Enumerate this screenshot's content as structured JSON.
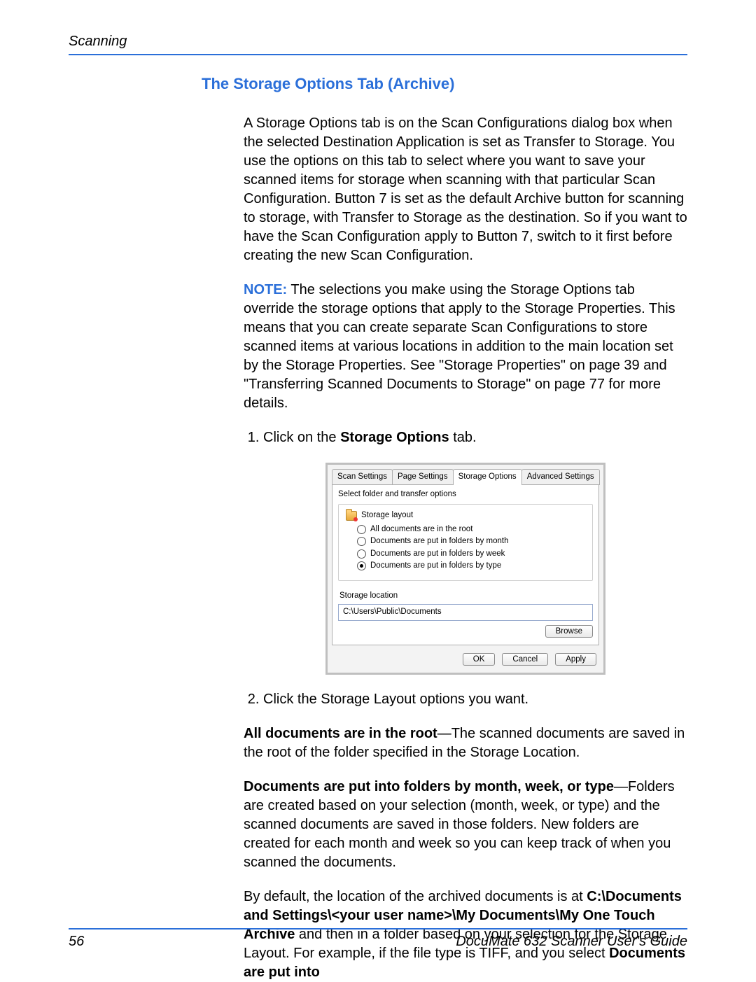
{
  "header": {
    "left": "Scanning",
    "right": ""
  },
  "section_title": "The Storage Options Tab (Archive)",
  "intro_paragraph": "A Storage Options tab is on the Scan Configurations dialog box when the selected Destination Application is set as Transfer to Storage. You use the options on this tab to select where you want to save your scanned items for storage when scanning with that particular Scan Configuration. Button 7 is set as the default Archive button for scanning to storage, with Transfer to Storage as the destination. So if you want to have the Scan Configuration apply to Button 7, switch to it first before creating the new Scan Configuration.",
  "note": {
    "label": "NOTE:",
    "text": "The selections you make using the Storage Options tab override the storage options that apply to the Storage Properties. This means that you can create separate Scan Configurations to store scanned items at various locations in addition to the main location set by the Storage Properties. See \"Storage Properties\" on page 39 and \"Transferring Scanned Documents to Storage\" on page 77 for more details."
  },
  "steps": {
    "s1_pre": "Click on the ",
    "s1_bold": "Storage Options",
    "s1_post": " tab.",
    "s2": "Click the Storage Layout options you want."
  },
  "explanations": {
    "root_bold": "All documents are in the root",
    "root_rest": "—The scanned documents are saved in the root of the folder specified in the Storage Location.",
    "folders_bold": "Documents are put into folders by month, week, or type",
    "folders_rest": "—Folders are created based on your selection (month, week, or type) and the scanned documents are saved in those folders. New folders are created for each month and week so you can keep track of when you scanned the documents.",
    "default_pre": "By default, the location of the archived documents is at ",
    "default_path": "C:\\Documents and Settings\\<your user name>\\My Documents\\My One Touch Archive",
    "default_mid": " and then in a folder based on your selection for the Storage Layout. For example, if the file type is TIFF, and you select ",
    "default_trail_bold": "Documents are put into"
  },
  "dialog": {
    "tabs": [
      "Scan Settings",
      "Page Settings",
      "Storage Options",
      "Advanced Settings"
    ],
    "active_tab_index": 2,
    "panel_label": "Select folder and transfer options",
    "group_title": "Storage layout",
    "options": [
      "All documents are in the root",
      "Documents are put in folders by month",
      "Documents are put in folders by week",
      "Documents are put in folders by type"
    ],
    "selected_option_index": 3,
    "location_label": "Storage location",
    "location_path": "C:\\Users\\Public\\Documents",
    "browse_label": "Browse",
    "ok_label": "OK",
    "cancel_label": "Cancel",
    "apply_label": "Apply"
  },
  "footer": {
    "page_number": "56",
    "guide": "DocuMate 632 Scanner User's Guide"
  }
}
